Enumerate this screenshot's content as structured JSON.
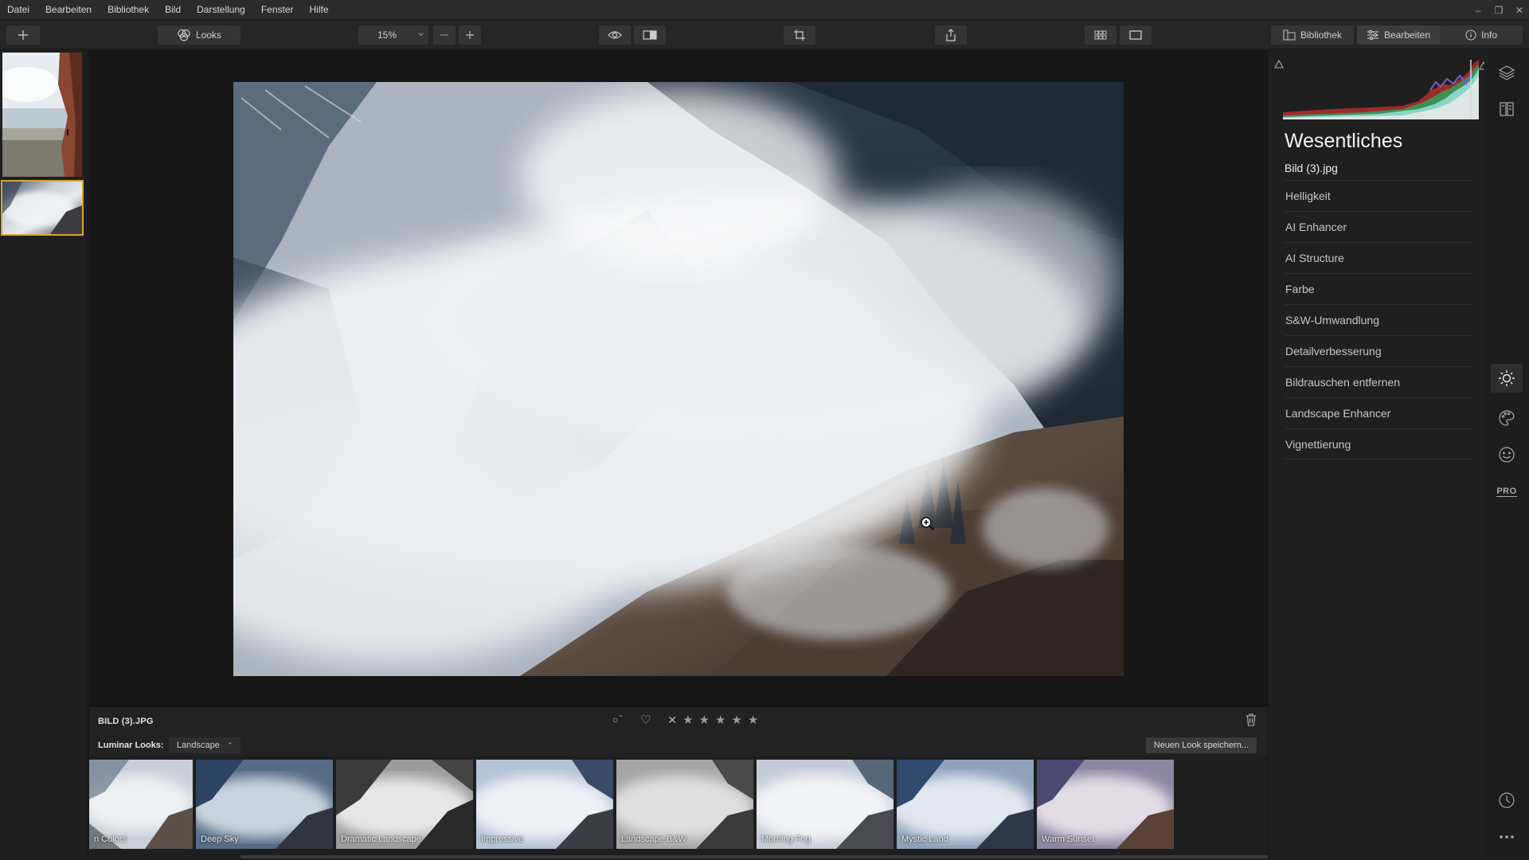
{
  "menubar": {
    "items": [
      "Datei",
      "Bearbeiten",
      "Bibliothek",
      "Bild",
      "Darstellung",
      "Fenster",
      "Hilfe"
    ]
  },
  "toolbar": {
    "looks_label": "Looks",
    "zoom_value": "15%",
    "tabs": {
      "library": "Bibliothek",
      "edit": "Bearbeiten",
      "info": "Info"
    }
  },
  "canvas": {
    "filename": "BILD (3).JPG",
    "rating_stars": 5,
    "rating_value": 0
  },
  "looks": {
    "label": "Luminar Looks:",
    "category": "Landscape",
    "save_button": "Neuen Look speichern...",
    "items": [
      "n Colors",
      "Deep Sky",
      "Dramatic Landscape",
      "Impressive",
      "Landscape B&W",
      "Morning Fog",
      "Mystic Land",
      "Warm Sunset"
    ]
  },
  "panel": {
    "title": "Wesentliches",
    "subtitle": "Bild (3).jpg",
    "tools": [
      "Helligkeit",
      "AI Enhancer",
      "AI Structure",
      "Farbe",
      "S&W-Umwandlung",
      "Detailverbesserung",
      "Bildrauschen entfernen",
      "Landscape Enhancer",
      "Vignettierung"
    ]
  },
  "rail": {
    "pro_label": "PRO"
  },
  "colors": {
    "selection_accent": "#d9a531",
    "panel_bg": "#1f1f1f",
    "canvas_bg": "#161616"
  }
}
